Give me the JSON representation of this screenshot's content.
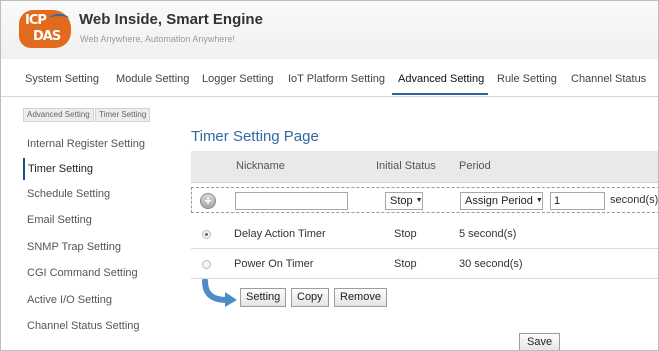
{
  "app": {
    "title": "Web Inside, Smart Engine",
    "subtitle": "Web Anywhere, Automation Anywhere!",
    "logo_line1": "ICP",
    "logo_line2": "DAS"
  },
  "topnav": {
    "items": [
      {
        "label": "System Setting"
      },
      {
        "label": "Module Setting"
      },
      {
        "label": "Logger Setting"
      },
      {
        "label": "IoT Platform Setting"
      },
      {
        "label": "Advanced Setting",
        "active": true
      },
      {
        "label": "Rule Setting"
      },
      {
        "label": "Channel Status"
      }
    ]
  },
  "breadcrumb": [
    "Advanced Setting",
    "Timer Setting"
  ],
  "sidebar": {
    "items": [
      {
        "label": "Internal Register Setting"
      },
      {
        "label": "Timer Setting",
        "active": true
      },
      {
        "label": "Schedule Setting"
      },
      {
        "label": "Email Setting"
      },
      {
        "label": "SNMP Trap Setting"
      },
      {
        "label": "CGI Command Setting"
      },
      {
        "label": "Active I/O Setting"
      },
      {
        "label": "Channel Status Setting"
      }
    ]
  },
  "main": {
    "title": "Timer Setting Page",
    "columns": {
      "nickname": "Nickname",
      "initial_status": "Initial Status",
      "period": "Period"
    },
    "add_row": {
      "add_icon": "plus-circle-icon",
      "nickname_value": "",
      "status_value": "Stop",
      "period_mode_value": "Assign Period",
      "period_value": "1",
      "unit": "second(s)"
    },
    "rows": [
      {
        "nickname": "Delay Action Timer",
        "status": "Stop",
        "period": "5 second(s)",
        "selected": true
      },
      {
        "nickname": "Power On Timer",
        "status": "Stop",
        "period": "30 second(s)",
        "selected": false
      }
    ],
    "buttons": {
      "setting": "Setting",
      "copy": "Copy",
      "remove": "Remove",
      "save": "Save"
    }
  },
  "colors": {
    "accent": "#2a64a0",
    "title": "#2f6aa3",
    "logo": "#e26a1c"
  }
}
